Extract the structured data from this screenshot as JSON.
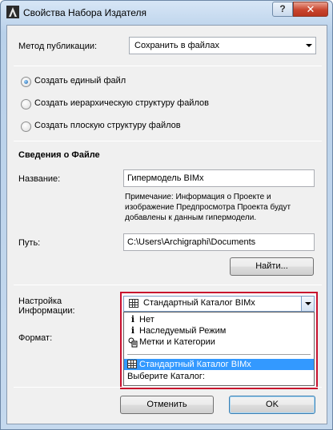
{
  "window": {
    "title": "Свойства Набора Издателя",
    "help_glyph": "?",
    "close_glyph": "✕"
  },
  "publish_method": {
    "label": "Метод публикации:",
    "value": "Сохранить в файлах"
  },
  "structure_options": [
    {
      "label": "Создать единый файл",
      "checked": true
    },
    {
      "label": "Создать иерархическую структуру файлов",
      "checked": false
    },
    {
      "label": "Создать плоскую структуру файлов",
      "checked": false
    }
  ],
  "file_info": {
    "section_title": "Сведения о Файле",
    "name_label": "Название:",
    "name_value": "Гипермодель BIMx",
    "note": "Примечание: Информация о Проекте и изображение Предпросмотра Проекта будут добавлены к данным гипермодели.",
    "path_label": "Путь:",
    "path_value": "C:\\Users\\Archigraphi\\Documents",
    "find_button": "Найти..."
  },
  "settings": {
    "info_label_line1": "Настройка",
    "info_label_line2": "Информации:",
    "format_label": "Формат:",
    "dropdown_value": "Стандартный Каталог BIMx",
    "options": {
      "none": "Нет",
      "inherited": "Наследуемый Режим",
      "marks": "Метки и Категории",
      "standard_catalog": "Стандартный Каталог BIMx",
      "choose_catalog": "Выберите Каталог:"
    },
    "none_icon": "i",
    "inherited_icon": "i"
  },
  "buttons": {
    "cancel": "Отменить",
    "ok": "OK"
  },
  "colors": {
    "highlight": "#c8102e",
    "selection": "#3399ff"
  }
}
